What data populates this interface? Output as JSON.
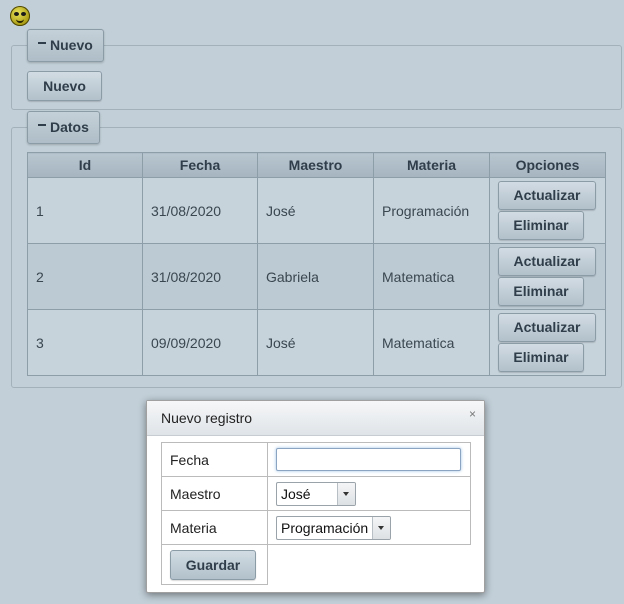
{
  "app": {
    "logo_icon": "smiley-icon"
  },
  "nuevo_panel": {
    "legend": "Nuevo",
    "button": "Nuevo"
  },
  "datos_panel": {
    "legend": "Datos",
    "columns": [
      "Id",
      "Fecha",
      "Maestro",
      "Materia",
      "Opciones"
    ],
    "rows": [
      {
        "id": "1",
        "fecha": "31/08/2020",
        "maestro": "José",
        "materia": "Programación",
        "update": "Actualizar",
        "delete": "Eliminar"
      },
      {
        "id": "2",
        "fecha": "31/08/2020",
        "maestro": "Gabriela",
        "materia": "Matematica",
        "update": "Actualizar",
        "delete": "Eliminar"
      },
      {
        "id": "3",
        "fecha": "09/09/2020",
        "maestro": "José",
        "materia": "Matematica",
        "update": "Actualizar",
        "delete": "Eliminar"
      }
    ]
  },
  "dialog": {
    "title": "Nuevo registro",
    "close": "×",
    "fecha_label": "Fecha",
    "fecha_value": "",
    "maestro_label": "Maestro",
    "maestro_selected": "José",
    "materia_label": "Materia",
    "materia_selected": "Programación",
    "save": "Guardar"
  }
}
